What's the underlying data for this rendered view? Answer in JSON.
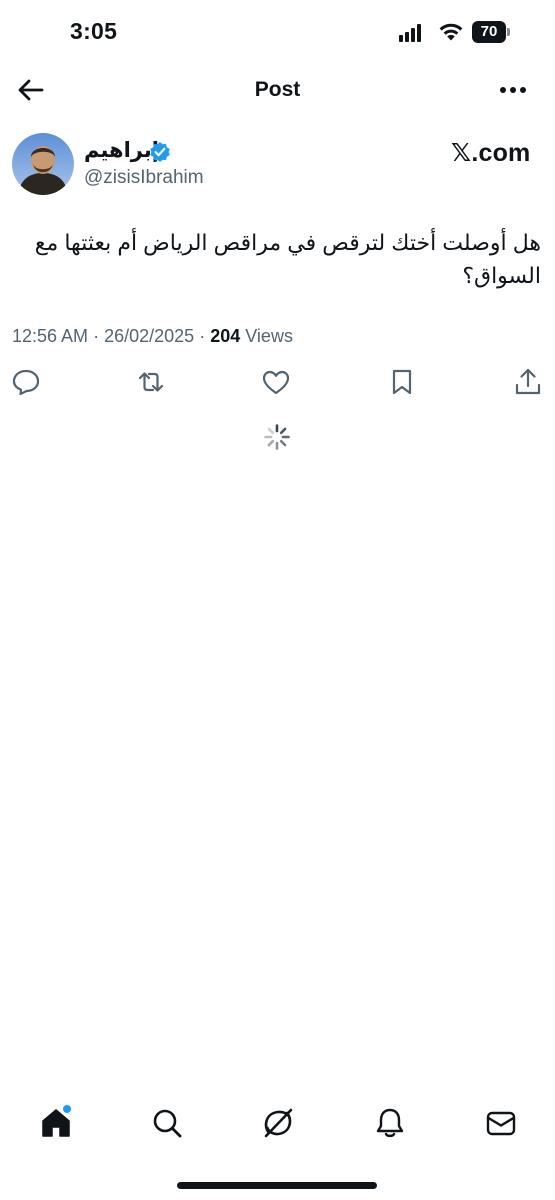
{
  "status_bar": {
    "time": "3:05",
    "battery": "70"
  },
  "header": {
    "title": "Post",
    "back_icon": "arrow-left-icon",
    "more_icon": "more-horizontal-icon"
  },
  "author": {
    "name": "إبراهيم",
    "handle": "@zisisIbrahim",
    "verified": true
  },
  "watermark": "𝕏.com",
  "tweet": {
    "text": "هل أوصلت أختك لترقص في مراقص الرياض أم بعثتها مع السواق؟",
    "time": "12:56 AM",
    "date": "26/02/2025",
    "views_count": "204",
    "views_label": "Views"
  },
  "actions": [
    "reply-icon",
    "repost-icon",
    "like-icon",
    "bookmark-icon",
    "share-icon"
  ],
  "bottom_nav": [
    "home-icon",
    "search-icon",
    "grok-icon",
    "notifications-icon",
    "messages-icon"
  ],
  "colors": {
    "accent": "#1d9bf0",
    "text": "#0f1419",
    "secondary": "#536471"
  }
}
